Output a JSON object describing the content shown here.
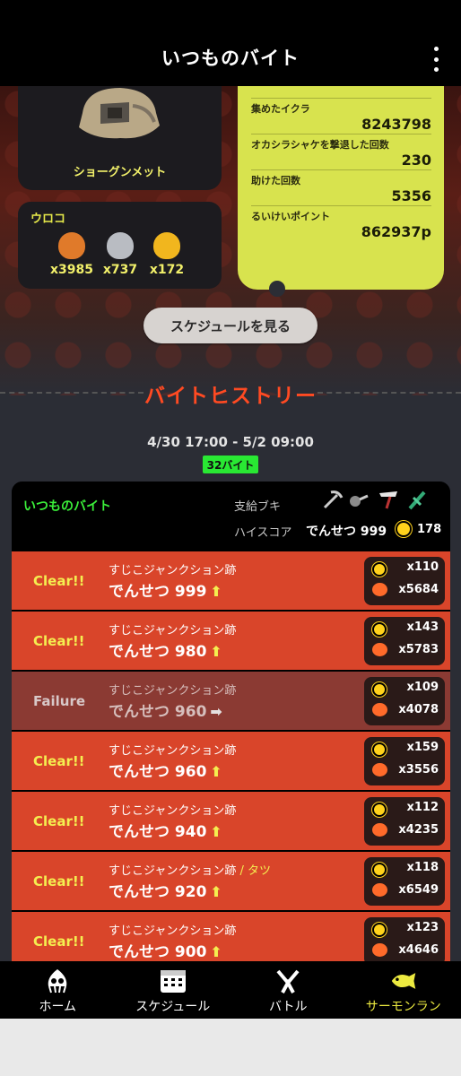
{
  "header": {
    "title": "いつものバイト"
  },
  "gear": {
    "name": "ショーグンメット"
  },
  "scales": {
    "title": "ウロコ",
    "items": [
      {
        "count": "x3985",
        "color": "#e07a2a"
      },
      {
        "count": "x737",
        "color": "#b9bcc2"
      },
      {
        "count": "x172",
        "color": "#f1b61e"
      }
    ]
  },
  "stats": [
    {
      "label": "集めたイクラ",
      "value": "8243798"
    },
    {
      "label": "オカシラシャケを撃退した回数",
      "value": "230"
    },
    {
      "label": "助けた回数",
      "value": "5356"
    },
    {
      "label": "るいけいポイント",
      "value": "862937p"
    }
  ],
  "schedule_button": "スケジュールを見る",
  "history": {
    "title": "バイトヒストリー",
    "range": "4/30 17:00 - 5/2 09:00",
    "count": "32バイト"
  },
  "list": {
    "title": "いつものバイト",
    "supply_label": "支給ブキ",
    "highscore_label": "ハイスコア",
    "highscore_value": "でんせつ 999",
    "highscore_eggs": "178",
    "rows": [
      {
        "result": "Clear!!",
        "status": "clear",
        "stage": "すじこジャンクション跡",
        "extra": "",
        "grade": "でんせつ 999",
        "arrow": "⬆",
        "golden": "x110",
        "power": "x5684"
      },
      {
        "result": "Clear!!",
        "status": "clear",
        "stage": "すじこジャンクション跡",
        "extra": "",
        "grade": "でんせつ 980",
        "arrow": "⬆",
        "golden": "x143",
        "power": "x5783"
      },
      {
        "result": "Failure",
        "status": "fail",
        "stage": "すじこジャンクション跡",
        "extra": "",
        "grade": "でんせつ 960",
        "arrow": "➡",
        "golden": "x109",
        "power": "x4078"
      },
      {
        "result": "Clear!!",
        "status": "clear",
        "stage": "すじこジャンクション跡",
        "extra": "",
        "grade": "でんせつ 960",
        "arrow": "⬆",
        "golden": "x159",
        "power": "x3556"
      },
      {
        "result": "Clear!!",
        "status": "clear",
        "stage": "すじこジャンクション跡",
        "extra": "",
        "grade": "でんせつ 940",
        "arrow": "⬆",
        "golden": "x112",
        "power": "x4235"
      },
      {
        "result": "Clear!!",
        "status": "clear",
        "stage": "すじこジャンクション跡",
        "extra": " / タツ",
        "grade": "でんせつ 920",
        "arrow": "⬆",
        "golden": "x118",
        "power": "x6549"
      },
      {
        "result": "Clear!!",
        "status": "clear",
        "stage": "すじこジャンクション跡",
        "extra": "",
        "grade": "でんせつ 900",
        "arrow": "⬆",
        "golden": "x123",
        "power": "x4646"
      }
    ]
  },
  "nav": {
    "tabs": [
      {
        "label": "ホーム",
        "icon": "squid-icon"
      },
      {
        "label": "スケジュール",
        "icon": "calendar-icon"
      },
      {
        "label": "バトル",
        "icon": "battle-icon"
      },
      {
        "label": "サーモンラン",
        "icon": "salmon-icon"
      }
    ],
    "active_color": "#ecea40"
  }
}
